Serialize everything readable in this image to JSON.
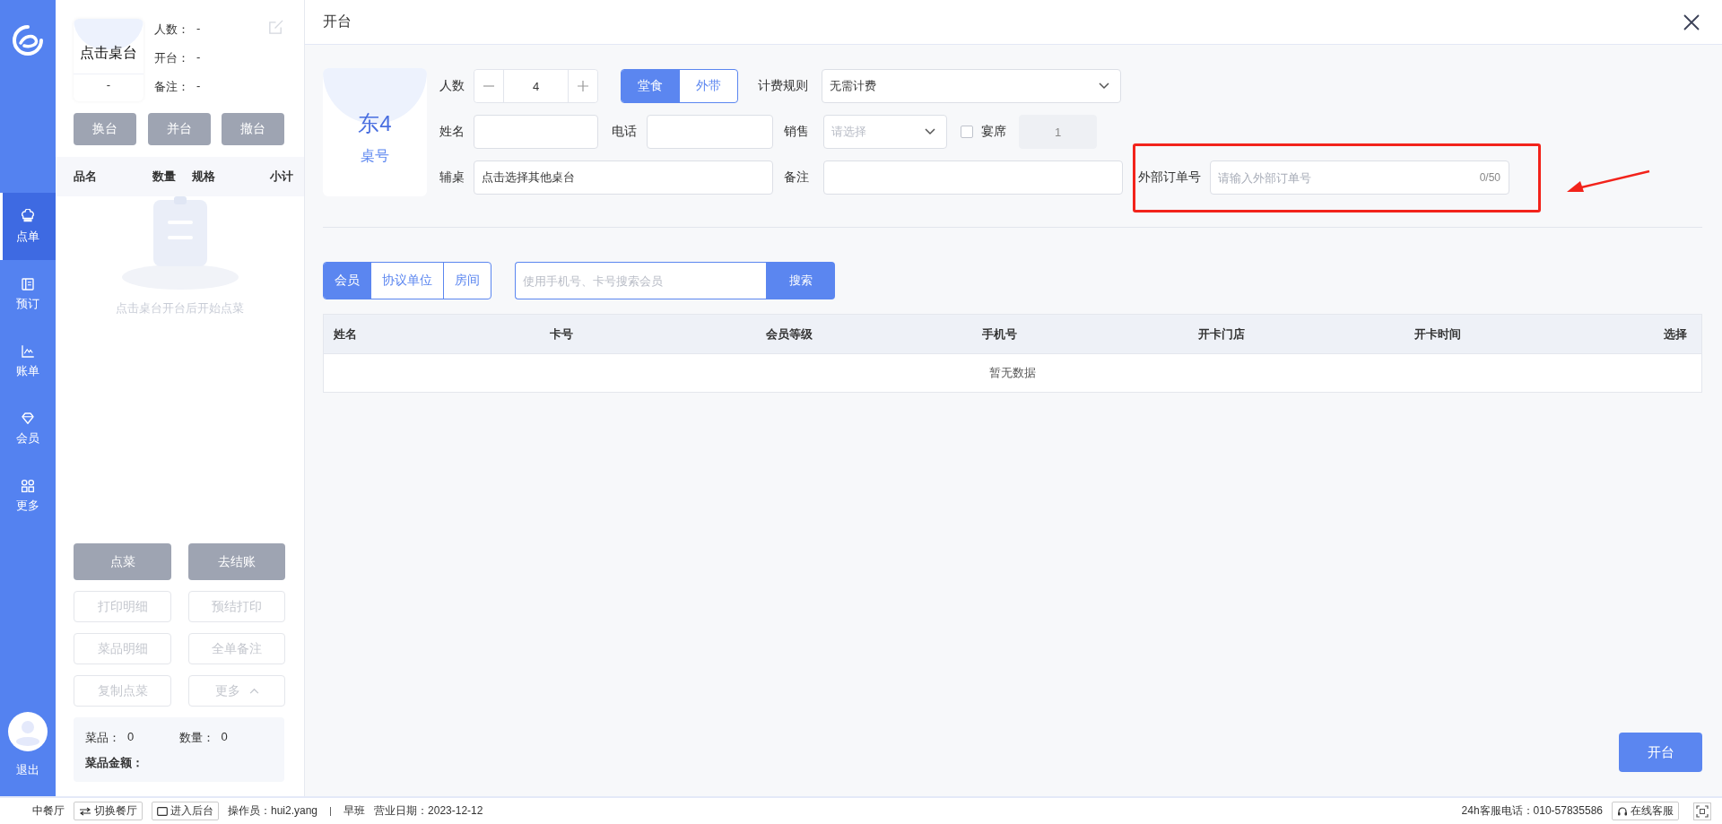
{
  "sidebar": {
    "items": [
      {
        "label": "点单",
        "selected": true
      },
      {
        "label": "预订",
        "selected": false
      },
      {
        "label": "账单",
        "selected": false
      },
      {
        "label": "会员",
        "selected": false
      },
      {
        "label": "更多",
        "selected": false
      }
    ],
    "logout": {
      "label": "退出"
    }
  },
  "order_panel": {
    "table_card": {
      "name": "点击桌台",
      "number": "-"
    },
    "info": [
      {
        "label": "人数：",
        "value": "-"
      },
      {
        "label": "开台：",
        "value": "-"
      },
      {
        "label": "备注：",
        "value": "-"
      }
    ],
    "table_buttons": [
      {
        "label": "换台",
        "disabled": true
      },
      {
        "label": "并台",
        "disabled": true
      },
      {
        "label": "撤台",
        "disabled": true
      }
    ],
    "columns": [
      "品名",
      "数量",
      "规格",
      "小计"
    ],
    "empty_text": "点击桌台开台后开始点菜",
    "actions": [
      {
        "label": "点菜",
        "kind": "solid",
        "disabled": true
      },
      {
        "label": "去结账",
        "kind": "solid",
        "disabled": true
      },
      {
        "label": "打印明细",
        "kind": "outline",
        "disabled": true
      },
      {
        "label": "预结打印",
        "kind": "outline",
        "disabled": true
      },
      {
        "label": "菜品明细",
        "kind": "outline",
        "disabled": true
      },
      {
        "label": "全单备注",
        "kind": "outline",
        "disabled": true
      },
      {
        "label": "复制点菜",
        "kind": "outline",
        "disabled": true
      },
      {
        "label": "更多",
        "kind": "menu",
        "disabled": true
      }
    ],
    "summary": {
      "items": [
        {
          "label": "菜品：",
          "value": "0"
        },
        {
          "label": "数量：",
          "value": "0"
        }
      ],
      "total_label": "菜品金额："
    }
  },
  "dialog": {
    "title": "开台",
    "table": {
      "name": "东4",
      "label": "桌号"
    },
    "people": {
      "label": "人数",
      "value": "4"
    },
    "dining_modes": [
      {
        "label": "堂食",
        "selected": true
      },
      {
        "label": "外带",
        "selected": false
      }
    ],
    "billing_rule": {
      "label": "计费规则",
      "value": "无需计费"
    },
    "name": {
      "label": "姓名"
    },
    "phone": {
      "label": "电话"
    },
    "sales": {
      "label": "销售",
      "placeholder": "请选择"
    },
    "banquet": {
      "label": "宴席",
      "checked": false,
      "count": "1",
      "disabled": true
    },
    "extra_tables": {
      "label": "辅桌",
      "value": "点击选择其他桌台"
    },
    "remark": {
      "label": "备注"
    },
    "external_order": {
      "label": "外部订单号",
      "placeholder": "请输入外部订单号",
      "counter": "0/50"
    },
    "member_tabs": [
      {
        "label": "会员",
        "selected": true
      },
      {
        "label": "协议单位",
        "selected": false
      },
      {
        "label": "房间",
        "selected": false
      }
    ],
    "search": {
      "placeholder": "使用手机号、卡号搜索会员",
      "button": "搜索"
    },
    "table_columns": [
      "姓名",
      "卡号",
      "会员等级",
      "手机号",
      "开卡门店",
      "开卡时间",
      "选择"
    ],
    "empty_text": "暂无数据",
    "submit": "开台"
  },
  "status_bar": {
    "left": [
      {
        "kind": "text",
        "text": "中餐厅"
      },
      {
        "kind": "button",
        "text": "切换餐厅"
      },
      {
        "kind": "button",
        "text": "进入后台"
      },
      {
        "kind": "text",
        "text": "操作员：hui2.yang"
      },
      {
        "kind": "separator"
      },
      {
        "kind": "text",
        "text": "早班"
      },
      {
        "kind": "text",
        "text": "营业日期：2023-12-12"
      }
    ],
    "right": [
      {
        "kind": "text",
        "text": "24h客服电话：010-57835586"
      },
      {
        "kind": "button",
        "text": "在线客服"
      },
      {
        "kind": "icon-button"
      }
    ]
  }
}
